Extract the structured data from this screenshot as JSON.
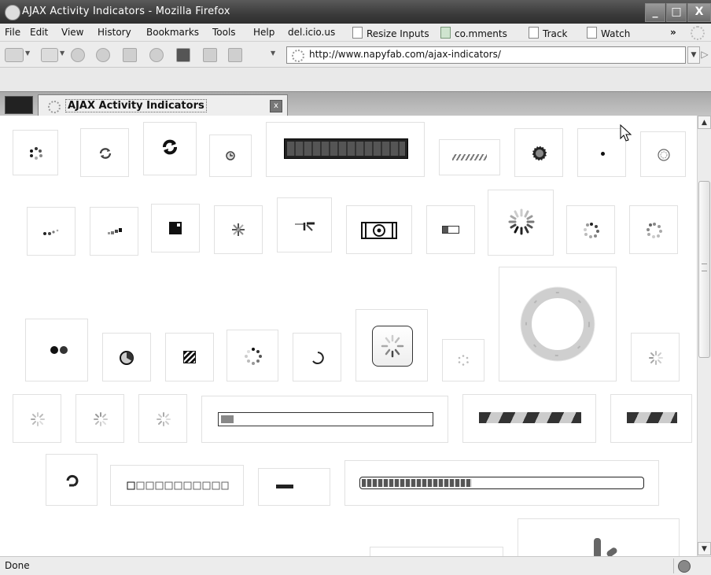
{
  "window": {
    "title": "AJAX Activity Indicators - Mozilla Firefox",
    "controls": {
      "minimize": "_",
      "maximize": "□",
      "close": "X"
    }
  },
  "menubar": {
    "items": [
      {
        "label": "File"
      },
      {
        "label": "Edit"
      },
      {
        "label": "View"
      },
      {
        "label": "History"
      },
      {
        "label": "Bookmarks"
      },
      {
        "label": "Tools"
      },
      {
        "label": "Help"
      }
    ],
    "bookmarks": [
      {
        "label": "del.icio.us"
      },
      {
        "label": "Resize Inputs"
      },
      {
        "label": "co.mments"
      },
      {
        "label": "Track"
      },
      {
        "label": "Watch"
      }
    ],
    "overflow": "»"
  },
  "navbar": {
    "url": "http://www.napyfab.com/ajax-indicators/",
    "dropdown": "▼",
    "go": "▷"
  },
  "tabs": {
    "active": {
      "label": "AJAX Activity Indicators",
      "close": "x"
    }
  },
  "scrollbar": {
    "up": "▲",
    "down": "▼"
  },
  "status": {
    "text": "Done"
  },
  "icons": {
    "back": "back-arrow-icon",
    "forward": "forward-arrow-icon",
    "reload": "reload-icon",
    "stop": "stop-icon",
    "home": "home-icon",
    "history": "history-icon",
    "page-info": "page-info-icon",
    "tag": "tag-icon",
    "window": "window-icon"
  }
}
